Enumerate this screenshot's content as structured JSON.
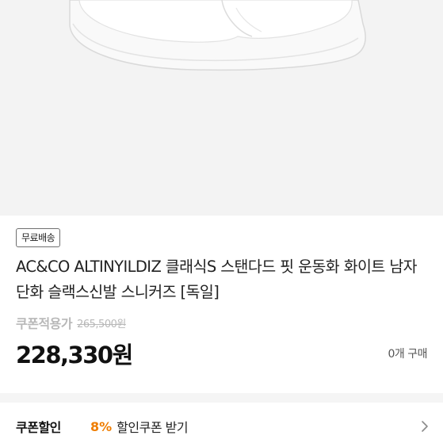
{
  "product": {
    "image_alt": "white sneaker",
    "shipping_badge": "무료배송",
    "title": "AC&CO ALTINYILDIZ 클래식S 스탠다드 핏 운동화 화이트 남자 단화 슬랙스신발 스니커즈 [독일]",
    "coupon_price_label": "쿠폰적용가",
    "original_price": "265,500원",
    "sale_price": "228,330원",
    "purchase_count": "0개 구매"
  },
  "coupon": {
    "label": "쿠폰할인",
    "rate": "8%",
    "action": "할인쿠폰 받기",
    "rate_color": "#ef7d00"
  },
  "icons": {
    "chevron": "chevron-right-icon"
  }
}
